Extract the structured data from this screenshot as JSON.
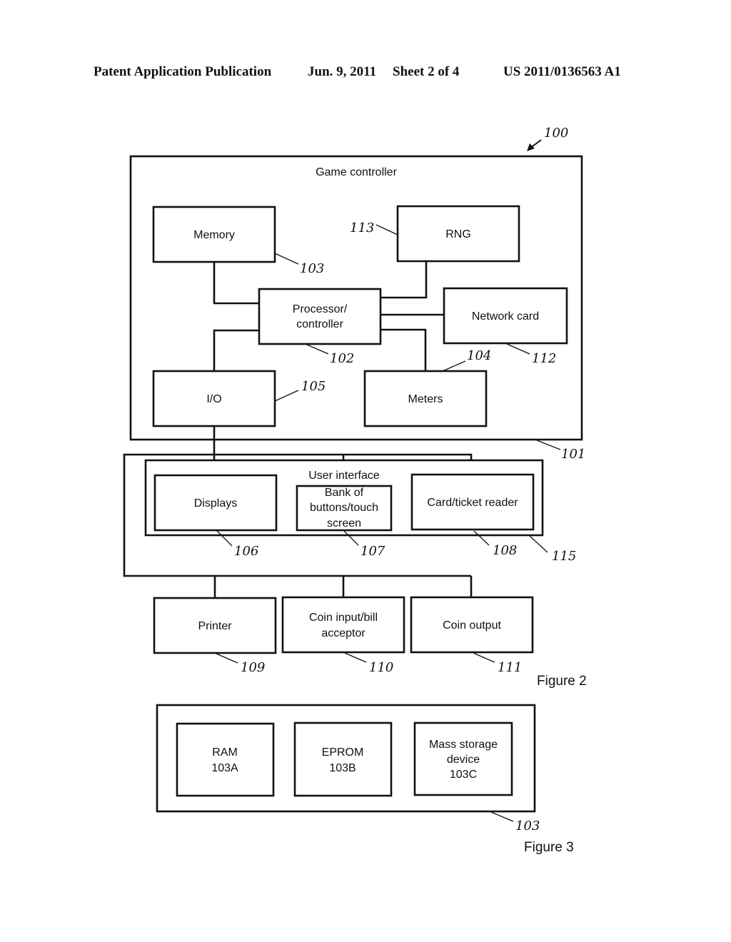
{
  "header": {
    "publication": "Patent Application Publication",
    "date": "Jun. 9, 2011",
    "sheet": "Sheet 2 of 4",
    "number": "US 2011/0136563 A1"
  },
  "figure2": {
    "caption": "Figure 2",
    "system_ref": "100",
    "game_controller": {
      "title": "Game controller",
      "ref": "101",
      "memory": {
        "label": "Memory",
        "ref": "103"
      },
      "rng": {
        "label": "RNG",
        "ref": "113"
      },
      "processor": {
        "line1": "Processor/",
        "line2": "controller",
        "ref": "102"
      },
      "network_card": {
        "label": "Network card",
        "ref": "112"
      },
      "io": {
        "label": "I/O",
        "ref": "105"
      },
      "meters": {
        "label": "Meters",
        "ref": "104"
      }
    },
    "user_interface": {
      "title": "User interface",
      "ref": "115",
      "displays": {
        "label": "Displays",
        "ref": "106"
      },
      "buttons": {
        "line1": "Bank of",
        "line2": "buttons/touch",
        "line3": "screen",
        "ref": "107"
      },
      "card_reader": {
        "label": "Card/ticket reader",
        "ref": "108"
      }
    },
    "peripherals": {
      "printer": {
        "label": "Printer",
        "ref": "109"
      },
      "coin_input": {
        "line1": "Coin input/bill",
        "line2": "acceptor",
        "ref": "110"
      },
      "coin_output": {
        "label": "Coin output",
        "ref": "111"
      }
    }
  },
  "figure3": {
    "caption": "Figure 3",
    "ref": "103",
    "ram": {
      "line1": "RAM",
      "line2": "103A"
    },
    "eprom": {
      "line1": "EPROM",
      "line2": "103B"
    },
    "mass_storage": {
      "line1": "Mass storage",
      "line2": "device",
      "line3": "103C"
    }
  }
}
